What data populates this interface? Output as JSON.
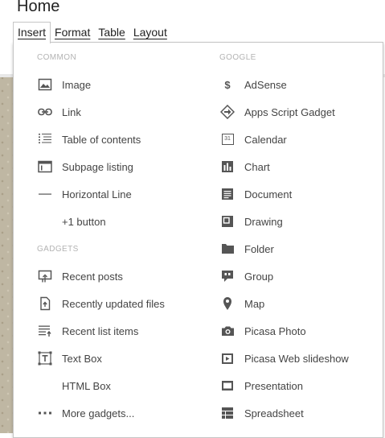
{
  "page": {
    "title": "Home"
  },
  "menubar": [
    {
      "label": "Insert",
      "active": true
    },
    {
      "label": "Format"
    },
    {
      "label": "Table"
    },
    {
      "label": "Layout"
    }
  ],
  "insert_menu": {
    "common_heading": "COMMON",
    "google_heading": "GOOGLE",
    "gadgets_heading": "GADGETS",
    "common": [
      {
        "label": "Image",
        "icon": "image-icon"
      },
      {
        "label": "Link",
        "icon": "link-icon"
      },
      {
        "label": "Table of contents",
        "icon": "table-of-contents-icon"
      },
      {
        "label": "Subpage listing",
        "icon": "subpage-listing-icon"
      },
      {
        "label": "Horizontal Line",
        "icon": "horizontal-line-icon"
      },
      {
        "label": "+1 button",
        "icon": ""
      }
    ],
    "gadgets": [
      {
        "label": "Recent posts",
        "icon": "recent-posts-icon"
      },
      {
        "label": "Recently updated files",
        "icon": "recently-updated-files-icon"
      },
      {
        "label": "Recent list items",
        "icon": "recent-list-items-icon"
      },
      {
        "label": "Text Box",
        "icon": "text-box-icon"
      },
      {
        "label": "HTML Box",
        "icon": ""
      },
      {
        "label": "More gadgets...",
        "icon": "more-icon"
      }
    ],
    "google": [
      {
        "label": "AdSense",
        "icon": "dollar-icon"
      },
      {
        "label": "Apps Script Gadget",
        "icon": "apps-script-icon"
      },
      {
        "label": "Calendar",
        "icon": "calendar-icon",
        "calendar_number": "31"
      },
      {
        "label": "Chart",
        "icon": "chart-icon"
      },
      {
        "label": "Document",
        "icon": "document-icon"
      },
      {
        "label": "Drawing",
        "icon": "drawing-icon"
      },
      {
        "label": "Folder",
        "icon": "folder-icon"
      },
      {
        "label": "Group",
        "icon": "group-icon"
      },
      {
        "label": "Map",
        "icon": "map-pin-icon"
      },
      {
        "label": "Picasa Photo",
        "icon": "camera-icon"
      },
      {
        "label": "Picasa Web slideshow",
        "icon": "slideshow-icon"
      },
      {
        "label": "Presentation",
        "icon": "presentation-icon"
      },
      {
        "label": "Spreadsheet",
        "icon": "spreadsheet-icon"
      }
    ]
  }
}
